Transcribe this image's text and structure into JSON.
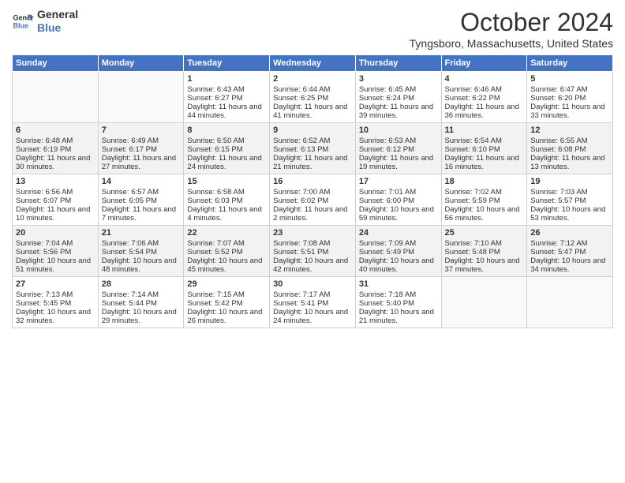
{
  "header": {
    "logo_line1": "General",
    "logo_line2": "Blue",
    "month": "October 2024",
    "location": "Tyngsboro, Massachusetts, United States"
  },
  "weekdays": [
    "Sunday",
    "Monday",
    "Tuesday",
    "Wednesday",
    "Thursday",
    "Friday",
    "Saturday"
  ],
  "rows": [
    [
      {
        "day": "",
        "content": ""
      },
      {
        "day": "",
        "content": ""
      },
      {
        "day": "1",
        "content": "Sunrise: 6:43 AM\nSunset: 6:27 PM\nDaylight: 11 hours and 44 minutes."
      },
      {
        "day": "2",
        "content": "Sunrise: 6:44 AM\nSunset: 6:25 PM\nDaylight: 11 hours and 41 minutes."
      },
      {
        "day": "3",
        "content": "Sunrise: 6:45 AM\nSunset: 6:24 PM\nDaylight: 11 hours and 39 minutes."
      },
      {
        "day": "4",
        "content": "Sunrise: 6:46 AM\nSunset: 6:22 PM\nDaylight: 11 hours and 36 minutes."
      },
      {
        "day": "5",
        "content": "Sunrise: 6:47 AM\nSunset: 6:20 PM\nDaylight: 11 hours and 33 minutes."
      }
    ],
    [
      {
        "day": "6",
        "content": "Sunrise: 6:48 AM\nSunset: 6:19 PM\nDaylight: 11 hours and 30 minutes."
      },
      {
        "day": "7",
        "content": "Sunrise: 6:49 AM\nSunset: 6:17 PM\nDaylight: 11 hours and 27 minutes."
      },
      {
        "day": "8",
        "content": "Sunrise: 6:50 AM\nSunset: 6:15 PM\nDaylight: 11 hours and 24 minutes."
      },
      {
        "day": "9",
        "content": "Sunrise: 6:52 AM\nSunset: 6:13 PM\nDaylight: 11 hours and 21 minutes."
      },
      {
        "day": "10",
        "content": "Sunrise: 6:53 AM\nSunset: 6:12 PM\nDaylight: 11 hours and 19 minutes."
      },
      {
        "day": "11",
        "content": "Sunrise: 6:54 AM\nSunset: 6:10 PM\nDaylight: 11 hours and 16 minutes."
      },
      {
        "day": "12",
        "content": "Sunrise: 6:55 AM\nSunset: 6:08 PM\nDaylight: 11 hours and 13 minutes."
      }
    ],
    [
      {
        "day": "13",
        "content": "Sunrise: 6:56 AM\nSunset: 6:07 PM\nDaylight: 11 hours and 10 minutes."
      },
      {
        "day": "14",
        "content": "Sunrise: 6:57 AM\nSunset: 6:05 PM\nDaylight: 11 hours and 7 minutes."
      },
      {
        "day": "15",
        "content": "Sunrise: 6:58 AM\nSunset: 6:03 PM\nDaylight: 11 hours and 4 minutes."
      },
      {
        "day": "16",
        "content": "Sunrise: 7:00 AM\nSunset: 6:02 PM\nDaylight: 11 hours and 2 minutes."
      },
      {
        "day": "17",
        "content": "Sunrise: 7:01 AM\nSunset: 6:00 PM\nDaylight: 10 hours and 59 minutes."
      },
      {
        "day": "18",
        "content": "Sunrise: 7:02 AM\nSunset: 5:59 PM\nDaylight: 10 hours and 56 minutes."
      },
      {
        "day": "19",
        "content": "Sunrise: 7:03 AM\nSunset: 5:57 PM\nDaylight: 10 hours and 53 minutes."
      }
    ],
    [
      {
        "day": "20",
        "content": "Sunrise: 7:04 AM\nSunset: 5:56 PM\nDaylight: 10 hours and 51 minutes."
      },
      {
        "day": "21",
        "content": "Sunrise: 7:06 AM\nSunset: 5:54 PM\nDaylight: 10 hours and 48 minutes."
      },
      {
        "day": "22",
        "content": "Sunrise: 7:07 AM\nSunset: 5:52 PM\nDaylight: 10 hours and 45 minutes."
      },
      {
        "day": "23",
        "content": "Sunrise: 7:08 AM\nSunset: 5:51 PM\nDaylight: 10 hours and 42 minutes."
      },
      {
        "day": "24",
        "content": "Sunrise: 7:09 AM\nSunset: 5:49 PM\nDaylight: 10 hours and 40 minutes."
      },
      {
        "day": "25",
        "content": "Sunrise: 7:10 AM\nSunset: 5:48 PM\nDaylight: 10 hours and 37 minutes."
      },
      {
        "day": "26",
        "content": "Sunrise: 7:12 AM\nSunset: 5:47 PM\nDaylight: 10 hours and 34 minutes."
      }
    ],
    [
      {
        "day": "27",
        "content": "Sunrise: 7:13 AM\nSunset: 5:45 PM\nDaylight: 10 hours and 32 minutes."
      },
      {
        "day": "28",
        "content": "Sunrise: 7:14 AM\nSunset: 5:44 PM\nDaylight: 10 hours and 29 minutes."
      },
      {
        "day": "29",
        "content": "Sunrise: 7:15 AM\nSunset: 5:42 PM\nDaylight: 10 hours and 26 minutes."
      },
      {
        "day": "30",
        "content": "Sunrise: 7:17 AM\nSunset: 5:41 PM\nDaylight: 10 hours and 24 minutes."
      },
      {
        "day": "31",
        "content": "Sunrise: 7:18 AM\nSunset: 5:40 PM\nDaylight: 10 hours and 21 minutes."
      },
      {
        "day": "",
        "content": ""
      },
      {
        "day": "",
        "content": ""
      }
    ]
  ]
}
